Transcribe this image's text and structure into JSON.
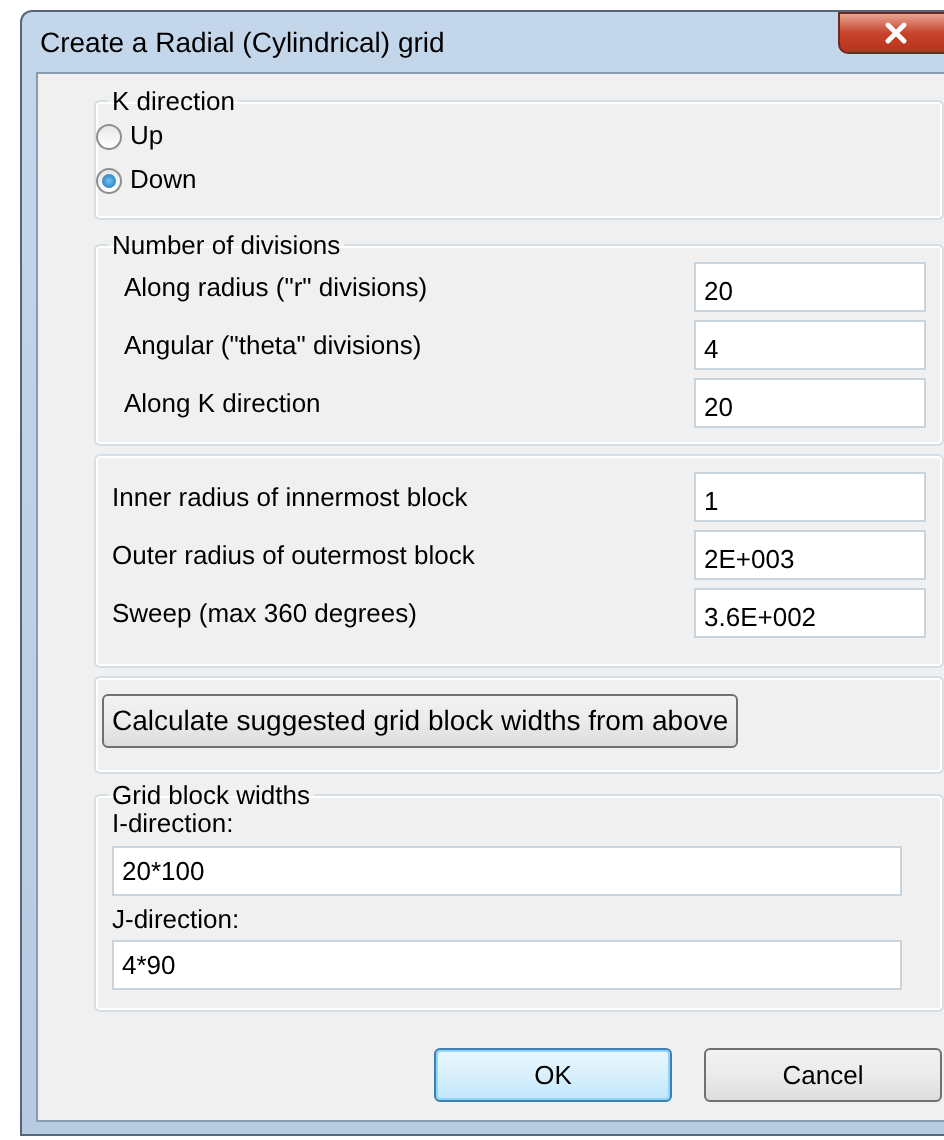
{
  "window": {
    "title": "Create a Radial (Cylindrical) grid"
  },
  "k_direction": {
    "title": "K direction",
    "options": [
      {
        "label": "Up",
        "selected": false
      },
      {
        "label": "Down",
        "selected": true
      }
    ]
  },
  "divisions": {
    "title": "Number of divisions",
    "fields": [
      {
        "label": "Along radius (\"r\" divisions)",
        "value": "20"
      },
      {
        "label": "Angular (\"theta\" divisions)",
        "value": "4"
      },
      {
        "label": "Along K direction",
        "value": "20"
      }
    ]
  },
  "geometry": {
    "fields": [
      {
        "label": "Inner radius of innermost block",
        "value": "1"
      },
      {
        "label": "Outer radius of outermost block",
        "value": "2E+003"
      },
      {
        "label": "Sweep (max 360 degrees)",
        "value": "3.6E+002"
      }
    ]
  },
  "calculate_button": "Calculate suggested grid block widths from above",
  "grid_block_widths": {
    "title": "Grid block widths",
    "fields": [
      {
        "label": "I-direction:",
        "value": "20*100"
      },
      {
        "label": "J-direction:",
        "value": "4*90"
      }
    ]
  },
  "buttons": [
    {
      "label": "OK",
      "default": true
    },
    {
      "label": "Cancel",
      "default": false
    }
  ]
}
